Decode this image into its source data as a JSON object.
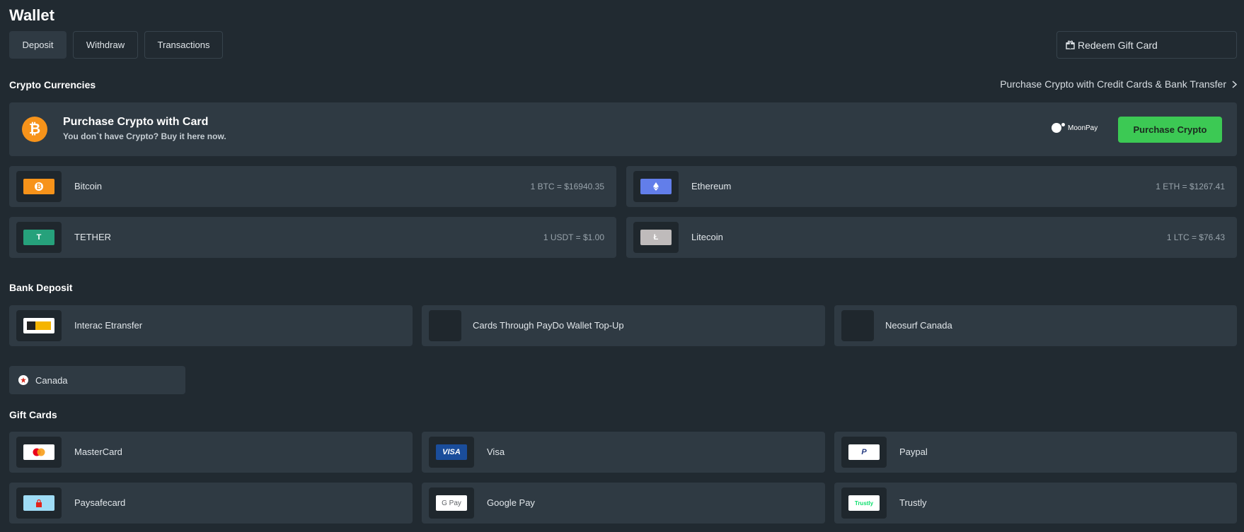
{
  "header": {
    "title": "Wallet",
    "tabs": [
      {
        "label": "Deposit",
        "active": true
      },
      {
        "label": "Withdraw",
        "active": false
      },
      {
        "label": "Transactions",
        "active": false
      }
    ],
    "redeem_label": "Redeem Gift Card",
    "redeem_icon": "gift-icon"
  },
  "crypto": {
    "section_title": "Crypto Currencies",
    "purchase_link": "Purchase Crypto with Credit Cards & Bank Transfer",
    "banner": {
      "title": "Purchase Crypto with Card",
      "subtitle": "You don`t have Crypto? Buy it here now.",
      "provider": "MoonPay",
      "button": "Purchase Crypto",
      "button_color": "#3cc954"
    },
    "items": [
      {
        "name": "Bitcoin",
        "rate": "1 BTC = $16940.35",
        "color": "#f7931a",
        "glyph": "₿"
      },
      {
        "name": "Ethereum",
        "rate": "1 ETH = $1267.41",
        "color": "#627eea",
        "glyph": "◆"
      },
      {
        "name": "TETHER",
        "rate": "1 USDT = $1.00",
        "color": "#26a17b",
        "glyph": "T"
      },
      {
        "name": "Litecoin",
        "rate": "1 LTC = $76.43",
        "color": "#bfbbbb",
        "glyph": "Ł"
      }
    ]
  },
  "bank": {
    "section_title": "Bank Deposit",
    "items": [
      {
        "name": "Interac Etransfer"
      },
      {
        "name": "Cards Through PayDo Wallet Top-Up"
      },
      {
        "name": "Neosurf Canada"
      }
    ],
    "country": "Canada"
  },
  "gift": {
    "section_title": "Gift Cards",
    "items": [
      {
        "name": "MasterCard"
      },
      {
        "name": "Visa",
        "logo_text": "VISA"
      },
      {
        "name": "Paypal",
        "logo_text": "P"
      },
      {
        "name": "Paysafecard"
      },
      {
        "name": "Google Pay",
        "logo_text": "G Pay"
      },
      {
        "name": "Trustly",
        "logo_text": "Trustly"
      }
    ]
  }
}
